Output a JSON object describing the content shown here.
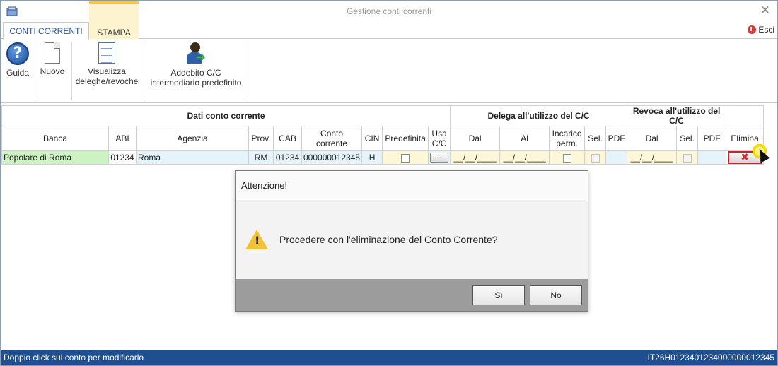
{
  "window": {
    "title": "Gestione conti correnti"
  },
  "tabs": [
    {
      "label": "CONTI CORRENTI",
      "active": true
    },
    {
      "label": "STAMPA",
      "active": false
    }
  ],
  "exit_label": "Esci",
  "ribbon": {
    "help": "Guida",
    "new": "Nuovo",
    "view_line1": "Visualizza",
    "view_line2": "deleghe/revoche",
    "addebito_line1": "Addebito C/C",
    "addebito_line2": "intermediario predefinito"
  },
  "grid": {
    "groups": {
      "dati": "Dati conto corrente",
      "delega": "Delega all'utilizzo del C/C",
      "revoca": "Revoca all'utilizzo del C/C"
    },
    "columns": {
      "banca": "Banca",
      "abi": "ABI",
      "agenzia": "Agenzia",
      "prov": "Prov.",
      "cab": "CAB",
      "conto_1": "Conto",
      "conto_2": "corrente",
      "cin": "CIN",
      "predefinita": "Predefinita",
      "usa_1": "Usa",
      "usa_2": "C/C",
      "dal": "Dal",
      "al": "Al",
      "incarico_1": "Incarico",
      "incarico_2": "perm.",
      "sel": "Sel.",
      "pdf": "PDF",
      "dal_rev": "Dal",
      "sel_rev": "Sel.",
      "pdf_rev": "PDF",
      "elimina": "Elimina"
    },
    "row": {
      "banca": "Popolare di Roma",
      "abi": "01234",
      "agenzia": "Roma",
      "prov": "RM",
      "cab": "01234",
      "conto": "000000012345",
      "cin": "H",
      "usa_btn": "...",
      "delega_dal": "__/__/____",
      "delega_al": "__/__/____",
      "revoca_dal": "__/__/____"
    }
  },
  "dialog": {
    "title": "Attenzione!",
    "message": "Procedere con l'eliminazione del Conto Corrente?",
    "yes": "Sì",
    "no": "No",
    "icon": "warning-icon"
  },
  "status": {
    "left": "Doppio click sul conto per modificarlo",
    "right": "IT26H0123401234000000012345"
  },
  "colors": {
    "statusbar": "#1f4f8e",
    "accent_tab": "#2b5797",
    "banca_cell": "#cdf3c2",
    "row_bg": "#e4f4fa",
    "delete_border": "#c0262d"
  }
}
